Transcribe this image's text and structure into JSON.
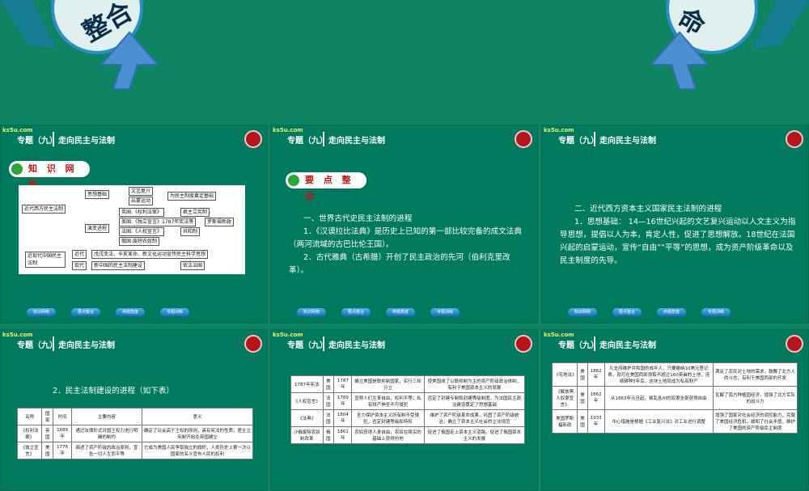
{
  "app_title": "专题（九）走向民主与法制",
  "colors": {
    "bg": "#0f8462",
    "accent_red": "#c81010",
    "home": "#b8141e"
  },
  "decor": {
    "left_text": "整合",
    "right_text": "命"
  },
  "header": {
    "series": "专题（九）",
    "title": "走向民主与法制",
    "logo": "ks5u.com"
  },
  "nav_buttons": [
    "知识网络",
    "要点整合",
    "命题角度",
    "专题训练"
  ],
  "slide1": {
    "section_label": "知 识 网 络",
    "diagram": {
      "root1": "近代西方民主法制",
      "root2": "近现代中国民主法制",
      "b1": "思想基础",
      "b2": "演变进程",
      "b3": "近代",
      "b4": "现代",
      "n1": "文艺复兴",
      "n2": "启蒙运动",
      "n3": "为民主制度奠定基础",
      "n4": "英国:《权利法案》",
      "n5": "君主立宪制",
      "n6": "美国:《独立宣言》1787年宪法等",
      "n7": "罗斯福新政",
      "n8": "法国:《人权宣言》",
      "n9": "共和制",
      "n10": "俄国:废除农奴制",
      "n11": "戊戌变法、辛亥革命、新文化运动宣传民主科学思想",
      "n12": "新中国的民主法制建设",
      "n13": "依法治国"
    }
  },
  "slide2": {
    "section_label": "要 点 整 合",
    "paragraphs": [
      "一、世界古代史民主法制的进程",
      "1．《汉谟拉比法典》是历史上已知的第一部比较完备的成文法典（两河流域的古巴比伦王国）。",
      "2．古代雅典（古希腊）开创了民主政治的先河（伯利克里改革）。"
    ]
  },
  "slide3": {
    "paragraphs": [
      "二、近代西方资本主义国家民主法制的进程",
      "1．思想基础： 14—16世纪兴起的文艺复兴运动以人文主义为指导思想，提倡以人为本，肯定人性，促进了思想解放。18世纪在法国兴起的启蒙运动，宣传“自由”“平等”的思想，成为资产阶级革命以及民主制度的先导。"
    ]
  },
  "slide4": {
    "paragraph": "2．民主法制建设的进程（如下表）",
    "table": {
      "headers": [
        "名称",
        "国家",
        "时间",
        "主要内容",
        "意义"
      ],
      "rows": [
        [
          "《权利法案》",
          "英国",
          "1689年",
          "通过法律形式对国王权力进行明确的制约",
          "确定了议会高于王权的原则，具有宪法的性质，君主立宪制开始在英国建立"
        ],
        [
          "《独立宣言》",
          "美国",
          "1776年",
          "阐述了资产阶级的政治原则，宣告一切人生而平等",
          "它成为美国人民争取独立的旗帜，人类历史上第一次以国家的名义宣布人民的权利"
        ]
      ]
    }
  },
  "slide5": {
    "table": {
      "rows": [
        [
          "1787年宪法",
          "美国",
          "1787年",
          "确立美国是联邦制国家，实行三权分立",
          "使美国成了以联邦制为主的资产阶级政治体制，有利于美国资本主义的发展"
        ],
        [
          "《人权宣言》",
          "法国",
          "1789年",
          "宣称人们生来自由，权利平等；私有财产神圣不可侵犯",
          "否定了封建专制和封建等级制度，为法国民主政治建设奠定了思想基础"
        ],
        [
          "《法典》",
          "法国",
          "1804年",
          "全力保护资本主义所有制不受侵犯，否定封建等级和特权",
          "维护了资产阶级革命成果，巩固了资产阶级统治，确立了资本主义社会的立法规范"
        ],
        [
          "沙俄废除农奴制改革",
          "俄国",
          "1861年",
          "农奴获得人身自由，农奴在赎买的基础上获得份地",
          "促进了俄国走上资本主义道路，促进了俄国资本主义的发展"
        ]
      ]
    }
  },
  "slide6": {
    "table": {
      "rows": [
        [
          "《宅地法》",
          "美国",
          "1862年",
          "凡支持维护共和国的成年人，只要缴纳10美元登记费，就可在美国西部领取不超过160英亩的土地，连续耕种5年后，这块土地就成为私有财产",
          "满足了农民对土地的需求，鼓舞了北方人的斗志，有利于美国西部的开发"
        ],
        [
          "《解放黑人奴隶宣言》",
          "美国",
          "1862年",
          "从1863年元旦起，叛乱各州的奴隶全部获得自由",
          "瓦解了南方种植园经济，增强了北方军队的战斗力"
        ],
        [
          "美国罗斯福新政",
          "美国",
          "1933年",
          "中心措施是根据《工业复兴法》对工业进行调整",
          "增强了国家对社会经济的调控能力，克服了美国经济危机，缓和了社会矛盾，维护了美国的资产阶级民主制度"
        ]
      ]
    }
  }
}
